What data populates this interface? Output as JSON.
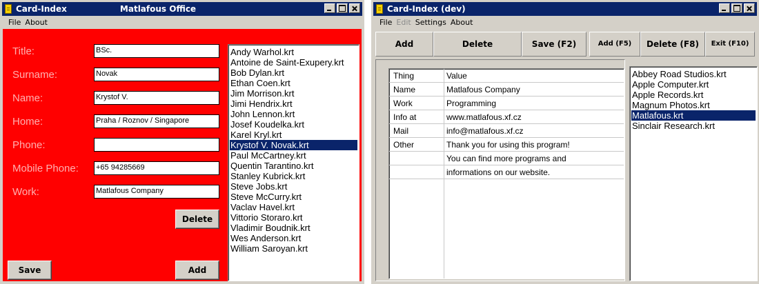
{
  "window_left": {
    "title": "Card-Index",
    "center_title": "Matlafous Office",
    "menu": [
      "File",
      "About"
    ],
    "fields": [
      {
        "label": "Title:",
        "value": "BSc."
      },
      {
        "label": "Surname:",
        "value": "Novak"
      },
      {
        "label": "Name:",
        "value": "Krystof V."
      },
      {
        "label": "Home:",
        "value": "Praha / Roznov / Singapore"
      },
      {
        "label": "Phone:",
        "value": ""
      },
      {
        "label": "Mobile Phone:",
        "value": "+65 94285669"
      },
      {
        "label": "Work:",
        "value": "Matlafous Company"
      }
    ],
    "buttons": {
      "delete": "Delete",
      "save": "Save",
      "add": "Add"
    },
    "list_items": [
      "Andy Warhol.krt",
      "Antoine de Saint-Exupery.krt",
      "Bob Dylan.krt",
      "Ethan Coen.krt",
      "Jim Morrison.krt",
      "Jimi Hendrix.krt",
      "John Lennon.krt",
      "Josef Koudelka.krt",
      "Karel Kryl.krt",
      "Krystof V. Novak.krt",
      "Paul McCartney.krt",
      "Quentin Tarantino.krt",
      "Stanley Kubrick.krt",
      "Steve Jobs.krt",
      "Steve McCurry.krt",
      "Vaclav Havel.krt",
      "Vittorio Storaro.krt",
      "Vladimir Boudnik.krt",
      "Wes Anderson.krt",
      "William Saroyan.krt"
    ],
    "selected_item": "Krystof V. Novak.krt"
  },
  "window_right": {
    "title": "Card-Index (dev)",
    "menu": {
      "file": "File",
      "edit": "Edit",
      "settings": "Settings",
      "about": "About"
    },
    "toolbar": {
      "add": "Add",
      "delete": "Delete",
      "save": "Save (F2)",
      "add_f5": "Add (F5)",
      "delete_f8": "Delete (F8)",
      "exit_f10": "Exit (F10)"
    },
    "grid_rows": [
      {
        "key": "Thing",
        "value": "Value"
      },
      {
        "key": "Name",
        "value": "Matlafous Company"
      },
      {
        "key": "Work",
        "value": "Programming"
      },
      {
        "key": "Info at",
        "value": "www.matlafous.xf.cz"
      },
      {
        "key": "Mail",
        "value": "info@matlafous.xf.cz"
      },
      {
        "key": "Other",
        "value": "Thank you for using this program!"
      },
      {
        "key": "",
        "value": "You can find more programs and"
      },
      {
        "key": "",
        "value": "informations on our website."
      }
    ],
    "list_items": [
      "Abbey Road Studios.krt",
      "Apple Computer.krt",
      "Apple Records.krt",
      "Magnum Photos.krt",
      "Matlafous.krt",
      "Sinclair Research.krt"
    ],
    "selected_item": "Matlafous.krt"
  },
  "colors": {
    "titlebar": "#0a246a",
    "form_background": "#ff0000",
    "field_label": "#ffb0b0",
    "selection": "#0a246a"
  }
}
